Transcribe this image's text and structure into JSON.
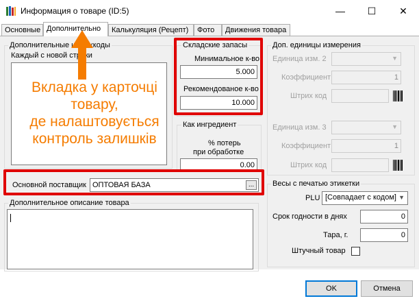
{
  "window": {
    "title": "Информация о товаре (ID:5)",
    "minimize": "—",
    "maximize": "☐",
    "close": "✕"
  },
  "tabs": [
    {
      "label": "Основные"
    },
    {
      "label": "Дополнительно",
      "active": true
    },
    {
      "label": "Калькуляция (Рецепт)"
    },
    {
      "label": "Фото"
    },
    {
      "label": "Движения товара"
    }
  ],
  "barcodes": {
    "group_title": "Дополнительные штрихкоды",
    "hint": "Каждый с новой строки"
  },
  "stock": {
    "group_title": "Складские запасы",
    "min_label": "Минимальное к-во",
    "min_value": "5.000",
    "rec_label": "Рекомендованое к-во",
    "rec_value": "10.000"
  },
  "ingredient": {
    "group_title": "Как ингредиент",
    "loss_label_1": "% потерь",
    "loss_label_2": "при обработке",
    "loss_value": "0.00"
  },
  "units": {
    "group_title": "Доп. единицы измерения",
    "unit2_label": "Единица изм. 2",
    "coef1_label": "Коэффициент",
    "coef1_value": "1",
    "barcode1_label": "Штрих код",
    "unit3_label": "Единица изм. 3",
    "coef2_label": "Коэффициент",
    "coef2_value": "1",
    "barcode2_label": "Штрих код"
  },
  "supplier": {
    "label": "Основной поставщик",
    "value": "ОПТОВАЯ БАЗА",
    "browse": "..."
  },
  "description": {
    "group_title": "Дополнительное описание товара"
  },
  "scales": {
    "group_title": "Весы с печатью этикетки",
    "plu_label": "PLU",
    "plu_value": "[Совпадает с кодом]",
    "shelf_label": "Срок годности в днях",
    "shelf_value": "0",
    "tare_label": "Тара, г.",
    "tare_value": "0",
    "piece_label": "Штучный товар"
  },
  "annotation": {
    "line1": "Вкладка у карточці",
    "line2": "товару,",
    "line3": "де налаштовується",
    "line4": "контроль залишків"
  },
  "buttons": {
    "ok": "OK",
    "cancel": "Отмена"
  },
  "colors": {
    "highlight": "#e00000",
    "annotation": "#f57c00",
    "accent": "#0078d7"
  }
}
